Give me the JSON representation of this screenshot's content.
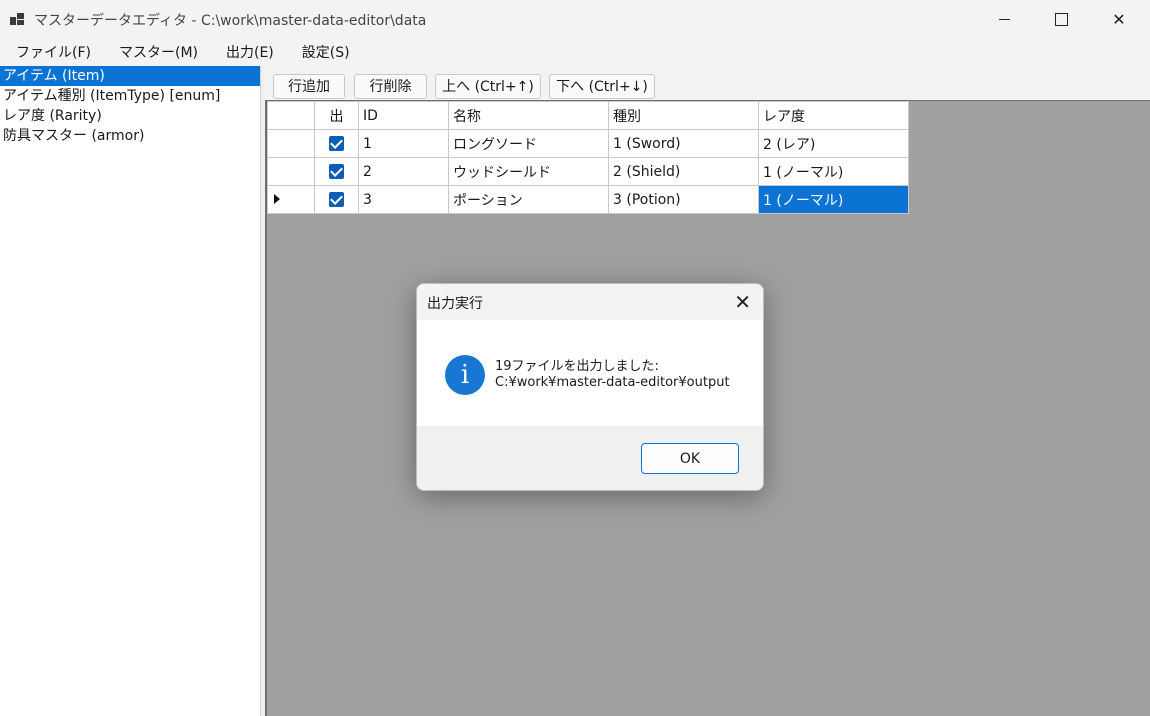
{
  "window": {
    "title": "マスターデータエディタ - C:\\work\\master-data-editor\\data",
    "minimize": "—",
    "close": "✕"
  },
  "menu": [
    "ファイル(F)",
    "マスター(M)",
    "出力(E)",
    "設定(S)"
  ],
  "masters": [
    {
      "label": "アイテム (Item)",
      "selected": true
    },
    {
      "label": "アイテム種別 (ItemType) [enum]",
      "selected": false
    },
    {
      "label": "レア度 (Rarity)",
      "selected": false
    },
    {
      "label": "防具マスター (armor)",
      "selected": false
    }
  ],
  "toolbar": {
    "add_row": "行追加",
    "delete_row": "行削除",
    "move_up": "上へ (Ctrl+↑)",
    "move_down": "下へ (Ctrl+↓)"
  },
  "grid": {
    "columns": {
      "out": "出",
      "id": "ID",
      "name": "名称",
      "type": "種別",
      "rarity": "レア度"
    },
    "rows": [
      {
        "out": true,
        "id": "1",
        "name": "ロングソード",
        "type": "1 (Sword)",
        "rarity": "2 (レア)"
      },
      {
        "out": true,
        "id": "2",
        "name": "ウッドシールド",
        "type": "2 (Shield)",
        "rarity": "1 (ノーマル)"
      },
      {
        "out": true,
        "id": "3",
        "name": "ポーション",
        "type": "3 (Potion)",
        "rarity": "1 (ノーマル)"
      }
    ]
  },
  "dialog": {
    "title": "出力実行",
    "close": "✕",
    "icon": "i",
    "message_line1": "19ファイルを出力しました:",
    "message_line2": "C:¥work¥master-data-editor¥output",
    "ok": "OK"
  },
  "colors": {
    "accent": "#0a73d4",
    "grid_background": "#a0a0a0"
  }
}
